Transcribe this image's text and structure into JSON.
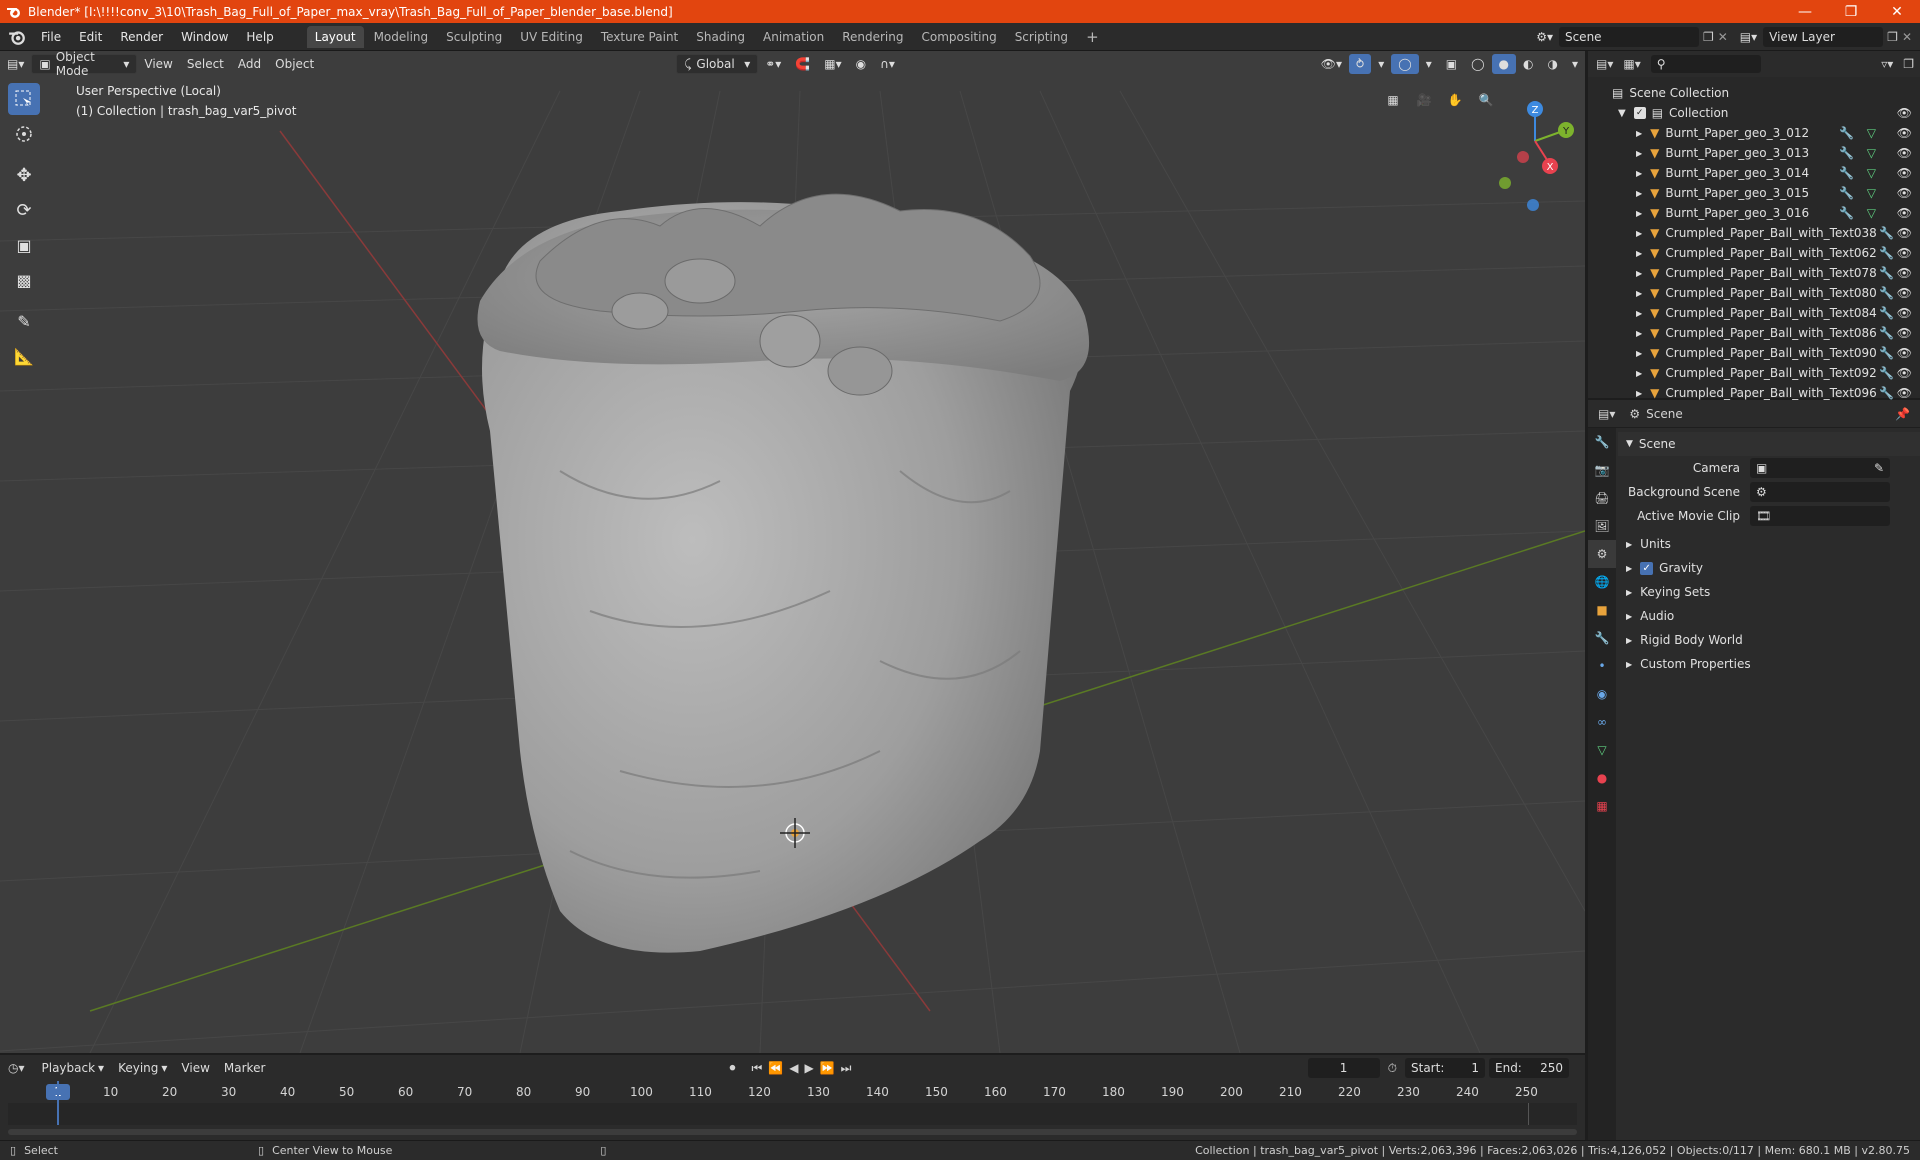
{
  "window": {
    "title": "Blender* [I:\\!!!!conv_3\\10\\Trash_Bag_Full_of_Paper_max_vray\\Trash_Bag_Full_of_Paper_blender_base.blend]"
  },
  "menu": {
    "items": [
      "File",
      "Edit",
      "Render",
      "Window",
      "Help"
    ]
  },
  "workspaces": [
    "Layout",
    "Modeling",
    "Sculpting",
    "UV Editing",
    "Texture Paint",
    "Shading",
    "Animation",
    "Rendering",
    "Compositing",
    "Scripting"
  ],
  "scene_field": "Scene",
  "view_layer_field": "View Layer",
  "viewport_header": {
    "mode": "Object Mode",
    "menus": [
      "View",
      "Select",
      "Add",
      "Object"
    ],
    "orientation": "Global"
  },
  "viewport_info": {
    "line1": "User Perspective (Local)",
    "line2": "(1) Collection | trash_bag_var5_pivot"
  },
  "gizmo": {
    "z": "Z",
    "y": "Y",
    "x": "X"
  },
  "outliner": {
    "root": "Scene Collection",
    "collection": "Collection",
    "items": [
      "Burnt_Paper_geo_3_012",
      "Burnt_Paper_geo_3_013",
      "Burnt_Paper_geo_3_014",
      "Burnt_Paper_geo_3_015",
      "Burnt_Paper_geo_3_016",
      "Crumpled_Paper_Ball_with_Text038",
      "Crumpled_Paper_Ball_with_Text062",
      "Crumpled_Paper_Ball_with_Text078",
      "Crumpled_Paper_Ball_with_Text080",
      "Crumpled_Paper_Ball_with_Text084",
      "Crumpled_Paper_Ball_with_Text086",
      "Crumpled_Paper_Ball_with_Text090",
      "Crumpled_Paper_Ball_with_Text092",
      "Crumpled_Paper_Ball_with_Text096"
    ]
  },
  "properties": {
    "header": "Scene",
    "panel_title": "Scene",
    "fields": [
      {
        "label": "Camera",
        "value": ""
      },
      {
        "label": "Background Scene",
        "value": ""
      },
      {
        "label": "Active Movie Clip",
        "value": ""
      }
    ],
    "subpanels": [
      "Units",
      "Gravity",
      "Keying Sets",
      "Audio",
      "Rigid Body World",
      "Custom Properties"
    ],
    "gravity_enabled": true
  },
  "timeline": {
    "menus": [
      "Playback",
      "Keying",
      "View",
      "Marker"
    ],
    "current_frame": "1",
    "start_label": "Start:",
    "start": "1",
    "end_label": "End:",
    "end": "250",
    "ruler": [
      "1",
      "10",
      "20",
      "30",
      "40",
      "50",
      "60",
      "70",
      "80",
      "90",
      "100",
      "110",
      "120",
      "130",
      "140",
      "150",
      "160",
      "170",
      "180",
      "190",
      "200",
      "210",
      "220",
      "230",
      "240",
      "250"
    ]
  },
  "statusbar": {
    "left": "Select",
    "middle": "Center View to Mouse",
    "right": "Collection | trash_bag_var5_pivot | Verts:2,063,396 | Faces:2,063,026 | Tris:4,126,052 | Objects:0/117 | Mem: 680.1 MB | v2.80.75"
  },
  "colors": {
    "titlebar": "#e2450f",
    "accent": "#4772b3",
    "x_axis": "#e8424f",
    "y_axis": "#7db32d",
    "z_axis": "#3d8ae0"
  }
}
